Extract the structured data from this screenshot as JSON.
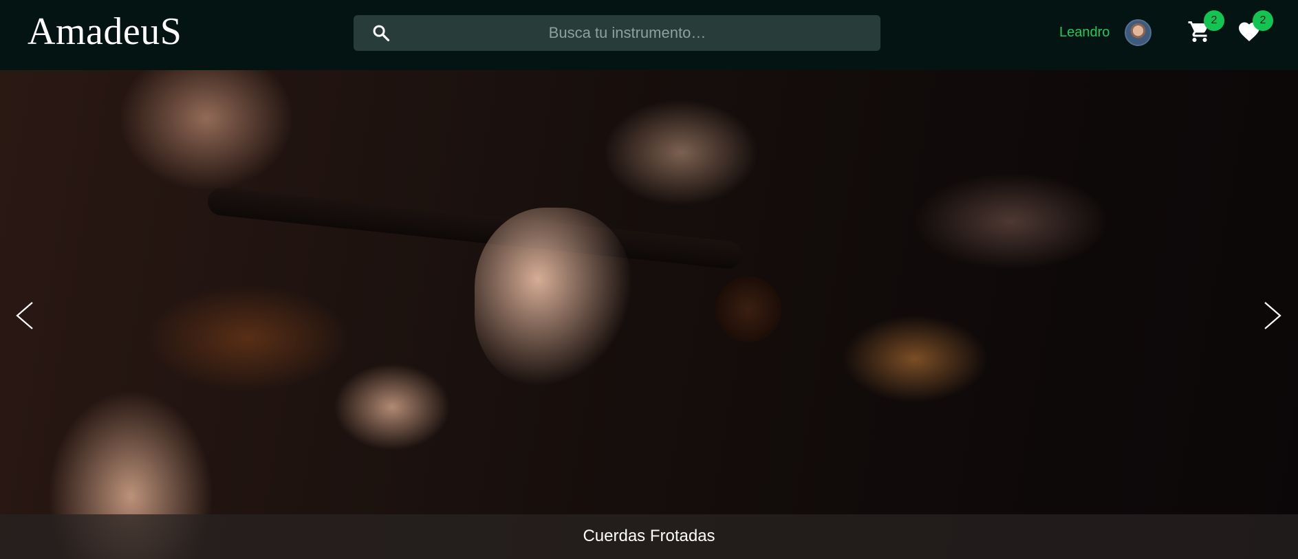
{
  "header": {
    "logo": "AmadeuS",
    "search": {
      "placeholder": "Busca tu instrumento…"
    },
    "user": {
      "name": "Leandro"
    },
    "cart": {
      "count": "2"
    },
    "favorites": {
      "count": "2"
    }
  },
  "carousel": {
    "slide_caption": "Cuerdas Frotadas",
    "prev_icon": "chevron-left-icon",
    "next_icon": "chevron-right-icon"
  },
  "icons": {
    "search": "search-icon",
    "cart": "cart-icon",
    "favorites": "heart-icon"
  },
  "colors": {
    "navbar_bg": "#031413",
    "search_bg": "#283c3a",
    "accent_green": "#1ecb5c",
    "badge_green": "#13c453"
  }
}
